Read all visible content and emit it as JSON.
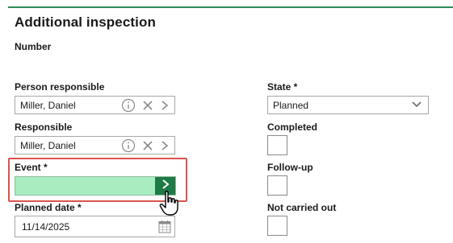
{
  "form": {
    "title": "Additional inspection",
    "number_label": "Number",
    "person_responsible": {
      "label": "Person responsible",
      "value": "Miller, Daniel"
    },
    "responsible": {
      "label": "Responsible",
      "value": "Miller, Daniel"
    },
    "event": {
      "label": "Event *",
      "value": ""
    },
    "planned_date": {
      "label": "Planned date *",
      "value": "11/14/2025"
    },
    "state": {
      "label": "State *",
      "value": "Planned"
    },
    "completed": {
      "label": "Completed",
      "checked": false
    },
    "follow_up": {
      "label": "Follow-up",
      "checked": false
    },
    "not_carried_out": {
      "label": "Not carried out",
      "checked": false
    }
  },
  "colors": {
    "accent": "#2e8b57",
    "event_fill": "#a8ecc0",
    "event_button": "#1e7a46",
    "highlight_border": "#d9534f"
  },
  "icons": [
    "info-icon",
    "clear-icon",
    "chevron-right-icon",
    "chevron-down-icon",
    "calendar-icon",
    "hand-pointer-cursor"
  ]
}
